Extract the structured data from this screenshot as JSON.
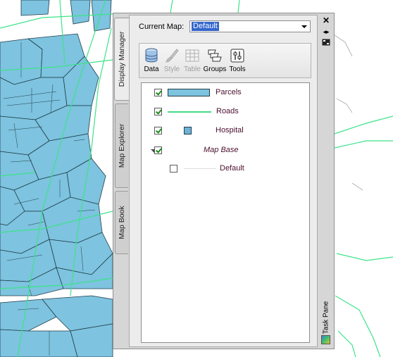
{
  "task_pane": {
    "title": "Task Pane",
    "tabs": [
      {
        "label": "Display Manager",
        "active": true
      },
      {
        "label": "Map Explorer",
        "active": false
      },
      {
        "label": "Map Book",
        "active": false
      }
    ],
    "current_map_label": "Current Map:",
    "current_map_value": "Default",
    "toolbar": [
      {
        "label": "Data",
        "enabled": true,
        "icon": "data-icon"
      },
      {
        "label": "Style",
        "enabled": false,
        "icon": "style-brush-icon"
      },
      {
        "label": "Table",
        "enabled": false,
        "icon": "table-icon"
      },
      {
        "label": "Groups",
        "enabled": true,
        "icon": "groups-icon"
      },
      {
        "label": "Tools",
        "enabled": true,
        "icon": "tools-icon"
      }
    ],
    "layers": [
      {
        "name": "Parcels",
        "checked": true,
        "swatch": "polygon",
        "color": "#7ec3df"
      },
      {
        "name": "Roads",
        "checked": true,
        "swatch": "line",
        "color": "#44dd88"
      },
      {
        "name": "Hospital",
        "checked": true,
        "swatch": "point",
        "color": "#6fb2d8"
      },
      {
        "name": "Map Base",
        "checked": true,
        "group": true,
        "expanded": true
      },
      {
        "name": "Default",
        "checked": false,
        "swatch": "line",
        "color": "#dddddd"
      }
    ]
  },
  "colors": {
    "parcel_fill": "#7ec3df",
    "road_line": "#3de38a",
    "selection": "#3366cc"
  }
}
